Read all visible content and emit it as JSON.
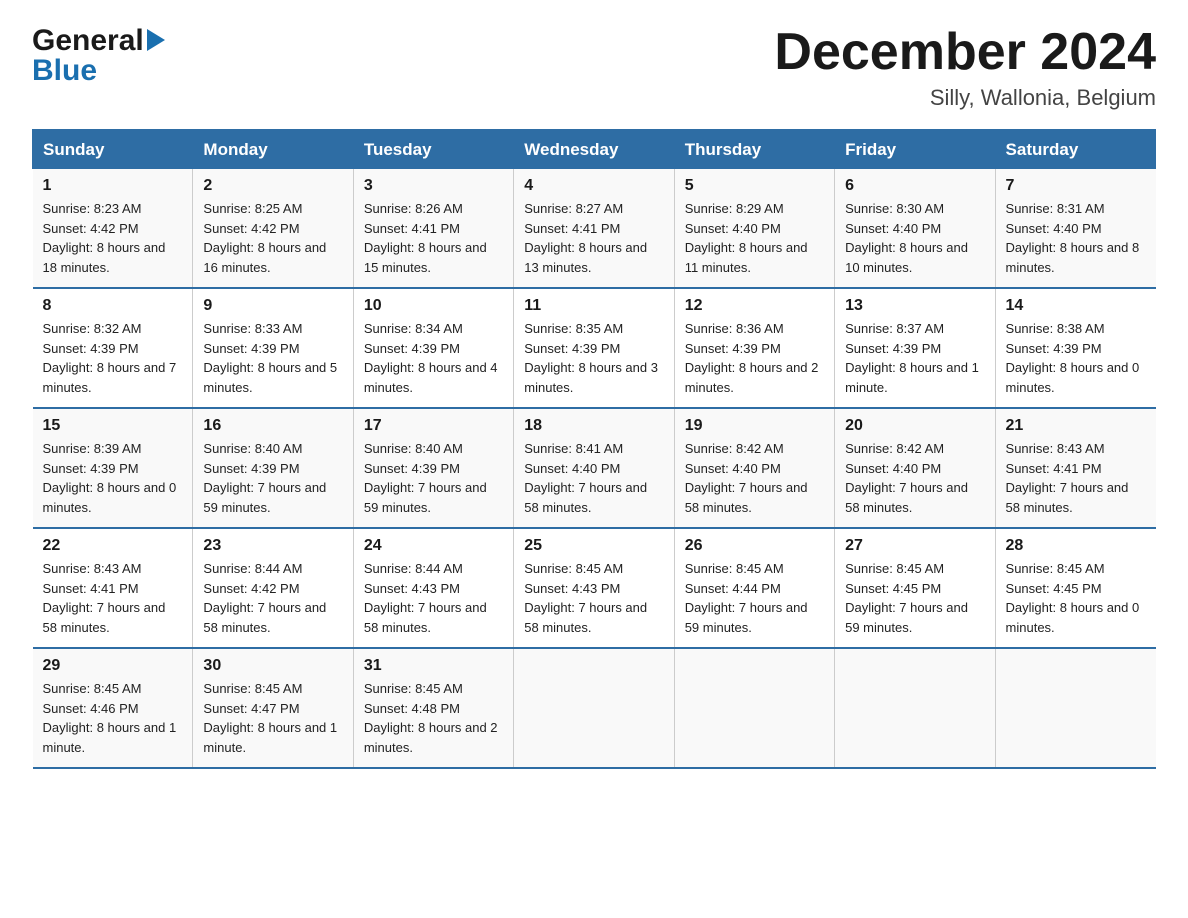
{
  "header": {
    "logo_general": "General",
    "logo_blue": "Blue",
    "month_title": "December 2024",
    "location": "Silly, Wallonia, Belgium"
  },
  "weekdays": [
    "Sunday",
    "Monday",
    "Tuesday",
    "Wednesday",
    "Thursday",
    "Friday",
    "Saturday"
  ],
  "weeks": [
    [
      {
        "day": "1",
        "sunrise": "8:23 AM",
        "sunset": "4:42 PM",
        "daylight": "8 hours and 18 minutes."
      },
      {
        "day": "2",
        "sunrise": "8:25 AM",
        "sunset": "4:42 PM",
        "daylight": "8 hours and 16 minutes."
      },
      {
        "day": "3",
        "sunrise": "8:26 AM",
        "sunset": "4:41 PM",
        "daylight": "8 hours and 15 minutes."
      },
      {
        "day": "4",
        "sunrise": "8:27 AM",
        "sunset": "4:41 PM",
        "daylight": "8 hours and 13 minutes."
      },
      {
        "day": "5",
        "sunrise": "8:29 AM",
        "sunset": "4:40 PM",
        "daylight": "8 hours and 11 minutes."
      },
      {
        "day": "6",
        "sunrise": "8:30 AM",
        "sunset": "4:40 PM",
        "daylight": "8 hours and 10 minutes."
      },
      {
        "day": "7",
        "sunrise": "8:31 AM",
        "sunset": "4:40 PM",
        "daylight": "8 hours and 8 minutes."
      }
    ],
    [
      {
        "day": "8",
        "sunrise": "8:32 AM",
        "sunset": "4:39 PM",
        "daylight": "8 hours and 7 minutes."
      },
      {
        "day": "9",
        "sunrise": "8:33 AM",
        "sunset": "4:39 PM",
        "daylight": "8 hours and 5 minutes."
      },
      {
        "day": "10",
        "sunrise": "8:34 AM",
        "sunset": "4:39 PM",
        "daylight": "8 hours and 4 minutes."
      },
      {
        "day": "11",
        "sunrise": "8:35 AM",
        "sunset": "4:39 PM",
        "daylight": "8 hours and 3 minutes."
      },
      {
        "day": "12",
        "sunrise": "8:36 AM",
        "sunset": "4:39 PM",
        "daylight": "8 hours and 2 minutes."
      },
      {
        "day": "13",
        "sunrise": "8:37 AM",
        "sunset": "4:39 PM",
        "daylight": "8 hours and 1 minute."
      },
      {
        "day": "14",
        "sunrise": "8:38 AM",
        "sunset": "4:39 PM",
        "daylight": "8 hours and 0 minutes."
      }
    ],
    [
      {
        "day": "15",
        "sunrise": "8:39 AM",
        "sunset": "4:39 PM",
        "daylight": "8 hours and 0 minutes."
      },
      {
        "day": "16",
        "sunrise": "8:40 AM",
        "sunset": "4:39 PM",
        "daylight": "7 hours and 59 minutes."
      },
      {
        "day": "17",
        "sunrise": "8:40 AM",
        "sunset": "4:39 PM",
        "daylight": "7 hours and 59 minutes."
      },
      {
        "day": "18",
        "sunrise": "8:41 AM",
        "sunset": "4:40 PM",
        "daylight": "7 hours and 58 minutes."
      },
      {
        "day": "19",
        "sunrise": "8:42 AM",
        "sunset": "4:40 PM",
        "daylight": "7 hours and 58 minutes."
      },
      {
        "day": "20",
        "sunrise": "8:42 AM",
        "sunset": "4:40 PM",
        "daylight": "7 hours and 58 minutes."
      },
      {
        "day": "21",
        "sunrise": "8:43 AM",
        "sunset": "4:41 PM",
        "daylight": "7 hours and 58 minutes."
      }
    ],
    [
      {
        "day": "22",
        "sunrise": "8:43 AM",
        "sunset": "4:41 PM",
        "daylight": "7 hours and 58 minutes."
      },
      {
        "day": "23",
        "sunrise": "8:44 AM",
        "sunset": "4:42 PM",
        "daylight": "7 hours and 58 minutes."
      },
      {
        "day": "24",
        "sunrise": "8:44 AM",
        "sunset": "4:43 PM",
        "daylight": "7 hours and 58 minutes."
      },
      {
        "day": "25",
        "sunrise": "8:45 AM",
        "sunset": "4:43 PM",
        "daylight": "7 hours and 58 minutes."
      },
      {
        "day": "26",
        "sunrise": "8:45 AM",
        "sunset": "4:44 PM",
        "daylight": "7 hours and 59 minutes."
      },
      {
        "day": "27",
        "sunrise": "8:45 AM",
        "sunset": "4:45 PM",
        "daylight": "7 hours and 59 minutes."
      },
      {
        "day": "28",
        "sunrise": "8:45 AM",
        "sunset": "4:45 PM",
        "daylight": "8 hours and 0 minutes."
      }
    ],
    [
      {
        "day": "29",
        "sunrise": "8:45 AM",
        "sunset": "4:46 PM",
        "daylight": "8 hours and 1 minute."
      },
      {
        "day": "30",
        "sunrise": "8:45 AM",
        "sunset": "4:47 PM",
        "daylight": "8 hours and 1 minute."
      },
      {
        "day": "31",
        "sunrise": "8:45 AM",
        "sunset": "4:48 PM",
        "daylight": "8 hours and 2 minutes."
      },
      null,
      null,
      null,
      null
    ]
  ],
  "sunrise_label": "Sunrise: ",
  "sunset_label": "Sunset: ",
  "daylight_label": "Daylight: "
}
